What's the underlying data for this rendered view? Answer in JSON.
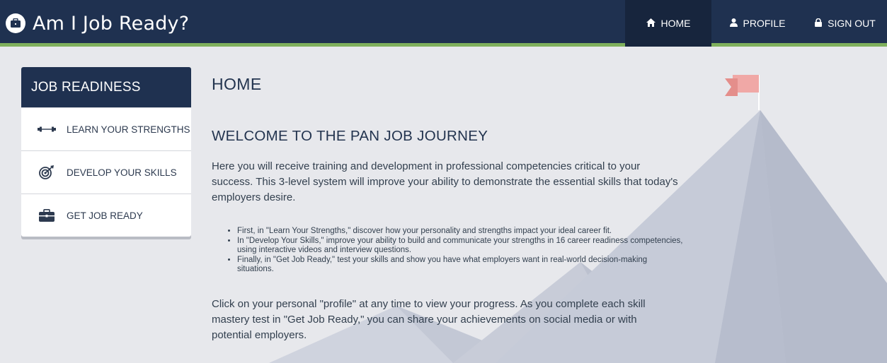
{
  "header": {
    "title": "Am I Job Ready?",
    "nav": [
      {
        "label": "HOME",
        "icon": "home-icon"
      },
      {
        "label": "PROFILE",
        "icon": "user-icon"
      },
      {
        "label": "SIGN OUT",
        "icon": "lock-icon"
      }
    ]
  },
  "sidebar": {
    "heading": "JOB READINESS",
    "items": [
      {
        "label": "LEARN YOUR STRENGTHS",
        "icon": "dumbbell-icon"
      },
      {
        "label": "DEVELOP YOUR SKILLS",
        "icon": "target-icon"
      },
      {
        "label": "GET JOB READY",
        "icon": "briefcase-icon"
      }
    ]
  },
  "main": {
    "page_title": "HOME",
    "section_title": "WELCOME TO THE PAN JOB JOURNEY",
    "intro": "Here you will receive training and development in professional competencies critical to your success. This 3-level system will improve your ability to demonstrate the essential skills that today's employers desire.",
    "bullets": [
      "First, in \"Learn Your Strengths,\" discover how your personality and strengths impact your ideal career fit.",
      "In \"Develop Your Skills,\" improve your ability to build and communicate your strengths in 16 career readiness competencies, using interactive videos and interview questions.",
      "Finally, in \"Get Job Ready,\" test your skills and show you have what employers want in real-world decision-making situations."
    ],
    "outro": "Click on your personal \"profile\" at any time to view your progress. As you complete each skill mastery test in \"Get Job Ready,\" you can share your achievements on social media or with potential employers."
  },
  "colors": {
    "header_bg": "#1f3150",
    "accent_green": "#7fb05c",
    "page_bg": "#e7e8ec",
    "flag": "#f0a8a6"
  }
}
